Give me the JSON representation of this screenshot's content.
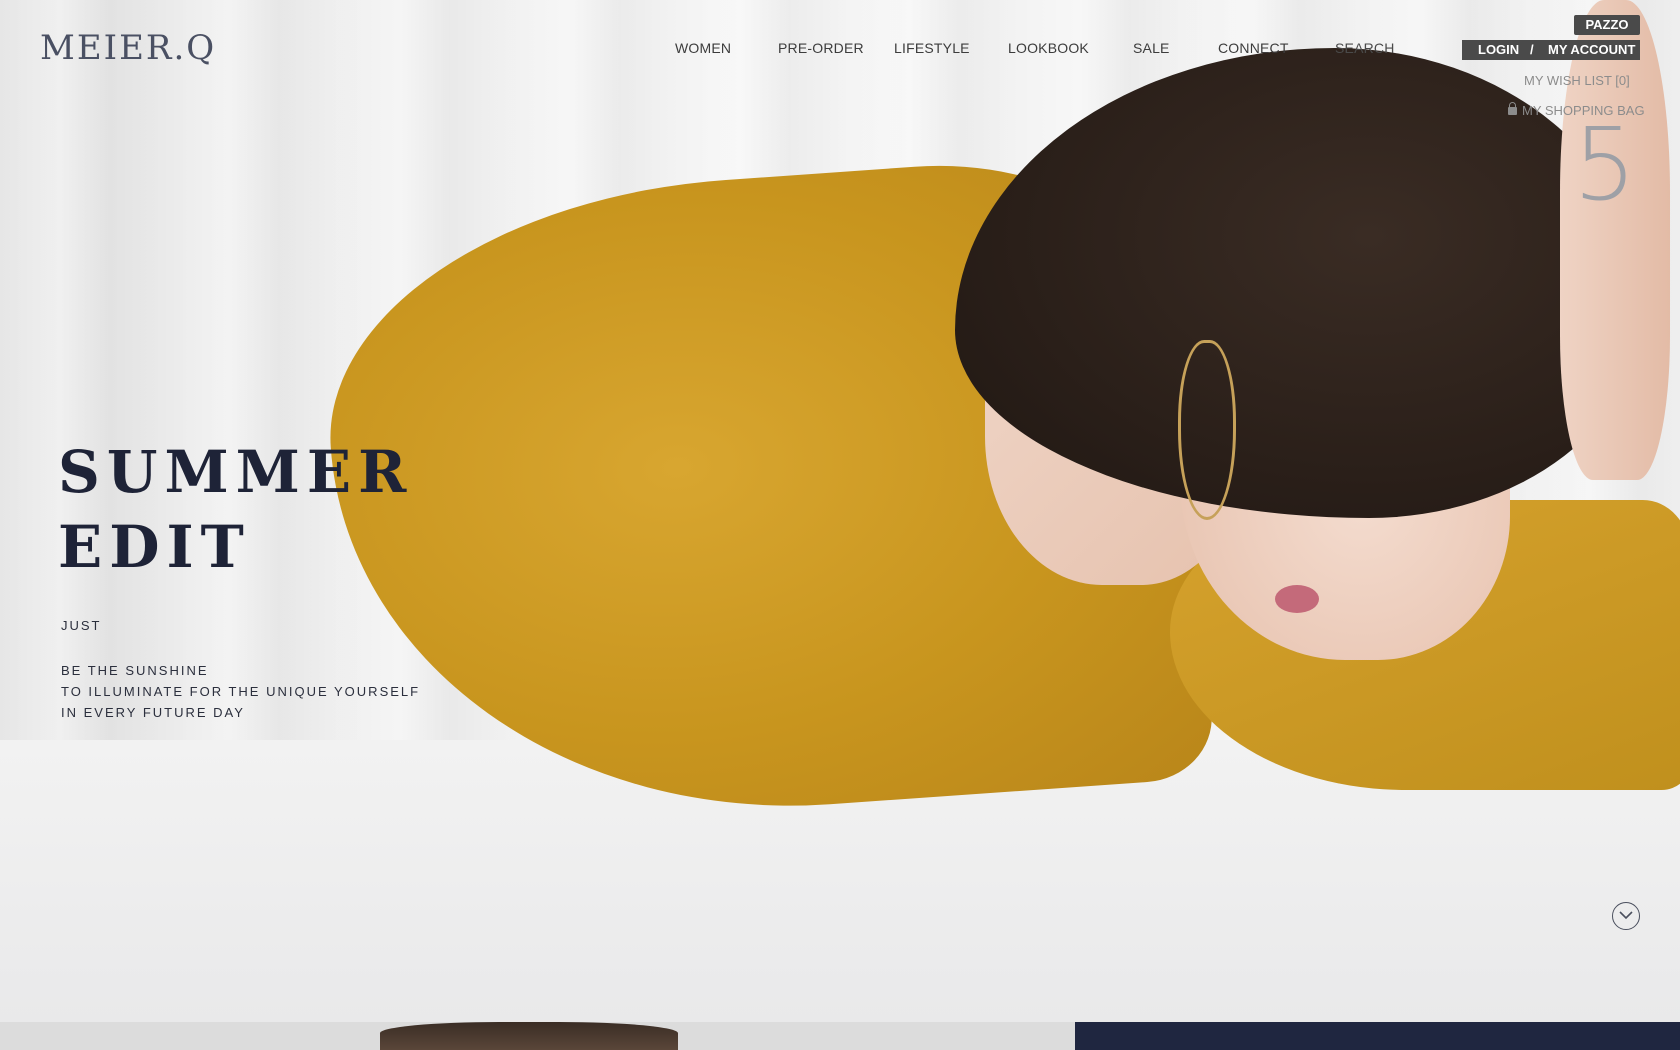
{
  "brand": {
    "logo": "MEIER.Q"
  },
  "nav": {
    "items": [
      "WOMEN",
      "PRE-ORDER",
      "LIFESTYLE",
      "LOOKBOOK",
      "SALE",
      "CONNECT"
    ],
    "search_label": "SEARCH"
  },
  "account": {
    "pazzo_label": "PAZZO",
    "login_label": "LOGIN",
    "separator": "/",
    "my_account_label": "MY ACCOUNT",
    "wish_list_label": "MY WISH LIST",
    "wish_list_count": "[0]",
    "shopping_bag_label": "MY SHOPPING BAG"
  },
  "hero": {
    "slide_number": "5",
    "headline_line1": "SUMMER",
    "headline_line2": "EDIT",
    "intro": "JUST",
    "tagline_line1": "BE THE SUNSHINE",
    "tagline_line2": "TO ILLUMINATE FOR THE UNIQUE YOURSELF",
    "tagline_line3": "IN EVERY FUTURE DAY"
  },
  "icons": {
    "scroll": "chevron-down-circle-icon",
    "bag": "lock-icon"
  },
  "colors": {
    "headline": "#1e2337",
    "account_bar": "#4a4a4a",
    "footer_panel": "#1f2640",
    "garment": "#c8951e"
  }
}
